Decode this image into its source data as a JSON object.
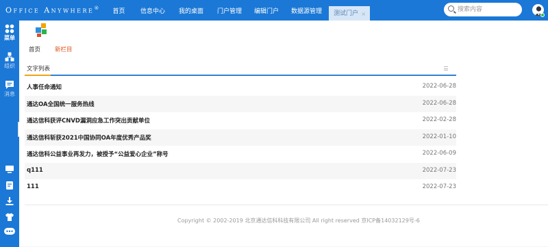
{
  "header": {
    "logo_text": "Office Anywhere",
    "logo_mark": "®",
    "nav": [
      {
        "label": "首页"
      },
      {
        "label": "信息中心"
      },
      {
        "label": "我的桌面"
      },
      {
        "label": "门户管理"
      },
      {
        "label": "编辑门户"
      },
      {
        "label": "数据源管理"
      },
      {
        "label": "测试门户",
        "active": true
      }
    ],
    "tab_close": "×",
    "search": {
      "placeholder": "搜索内容"
    },
    "brand_color": "#1b78d6",
    "online_status_color": "#2fbf4a"
  },
  "sidebar": {
    "items": [
      {
        "icon": "grid-icon",
        "label": "菜单"
      },
      {
        "icon": "org-icon",
        "label": "组织"
      },
      {
        "icon": "message-icon",
        "label": "消息"
      }
    ],
    "bottom_icons": [
      "monitor-icon",
      "note-icon",
      "download-icon",
      "shirt-icon",
      "more-icon"
    ]
  },
  "breadcrumb": {
    "home": "首页",
    "new_column": "新栏目"
  },
  "panel": {
    "tab_title": "文字列表",
    "accent_color": "#f0a21a",
    "underline_color": "#2f7fd3"
  },
  "articles": [
    {
      "title": "人事任命通知",
      "date": "2022-06-28"
    },
    {
      "title": "通达OA全国统一服务热线",
      "date": "2022-06-28"
    },
    {
      "title": "通达信科获评CNVD漏洞应急工作突出贡献单位",
      "date": "2022-02-28"
    },
    {
      "title": "通达信科斩获2021中国协同OA年度优秀产品奖",
      "date": "2022-01-10"
    },
    {
      "title": "通达信科公益事业再发力，被授予“公益爱心企业”称号",
      "date": "2022-06-09"
    },
    {
      "title": "q111",
      "date": "2022-07-23"
    },
    {
      "title": "111",
      "date": "2022-07-23"
    }
  ],
  "footer": {
    "text": "Copyright © 2002-2019 北京通达信科科技有限公司 All right reserved 京ICP备14032129号-6"
  }
}
